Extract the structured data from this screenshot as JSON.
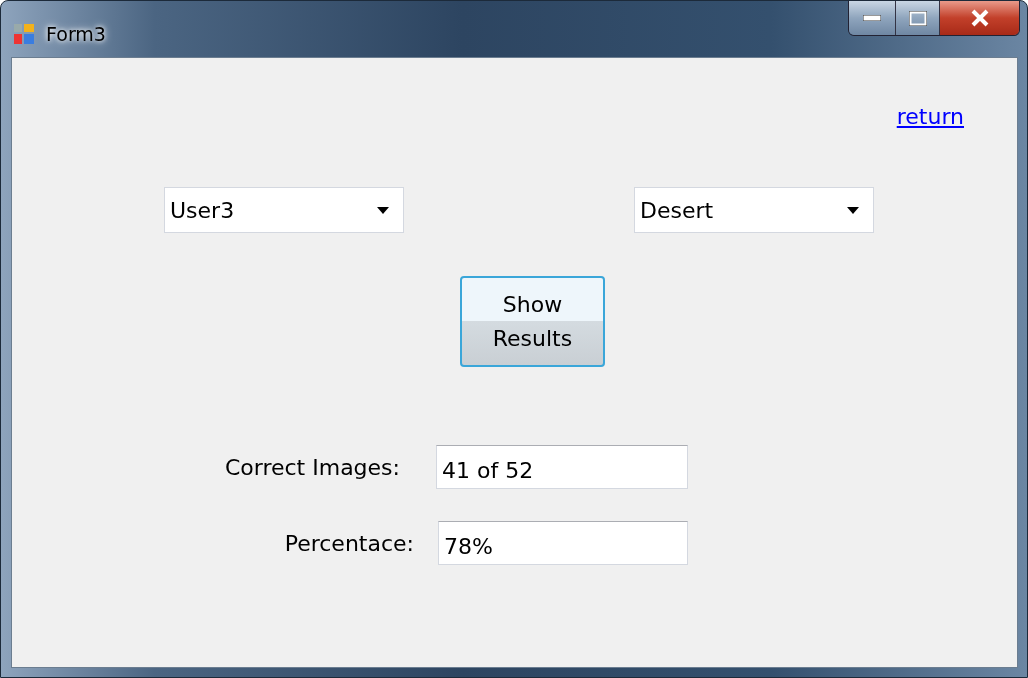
{
  "window": {
    "title": "Form3"
  },
  "return_link": "return",
  "dropdowns": [
    {
      "value": "User3"
    },
    {
      "value": "Desert"
    }
  ],
  "show_button": "Show Results",
  "fields": [
    {
      "label": "Correct Images:",
      "value": "41 of 52"
    },
    {
      "label": "Percentace:",
      "value": "78%"
    }
  ]
}
